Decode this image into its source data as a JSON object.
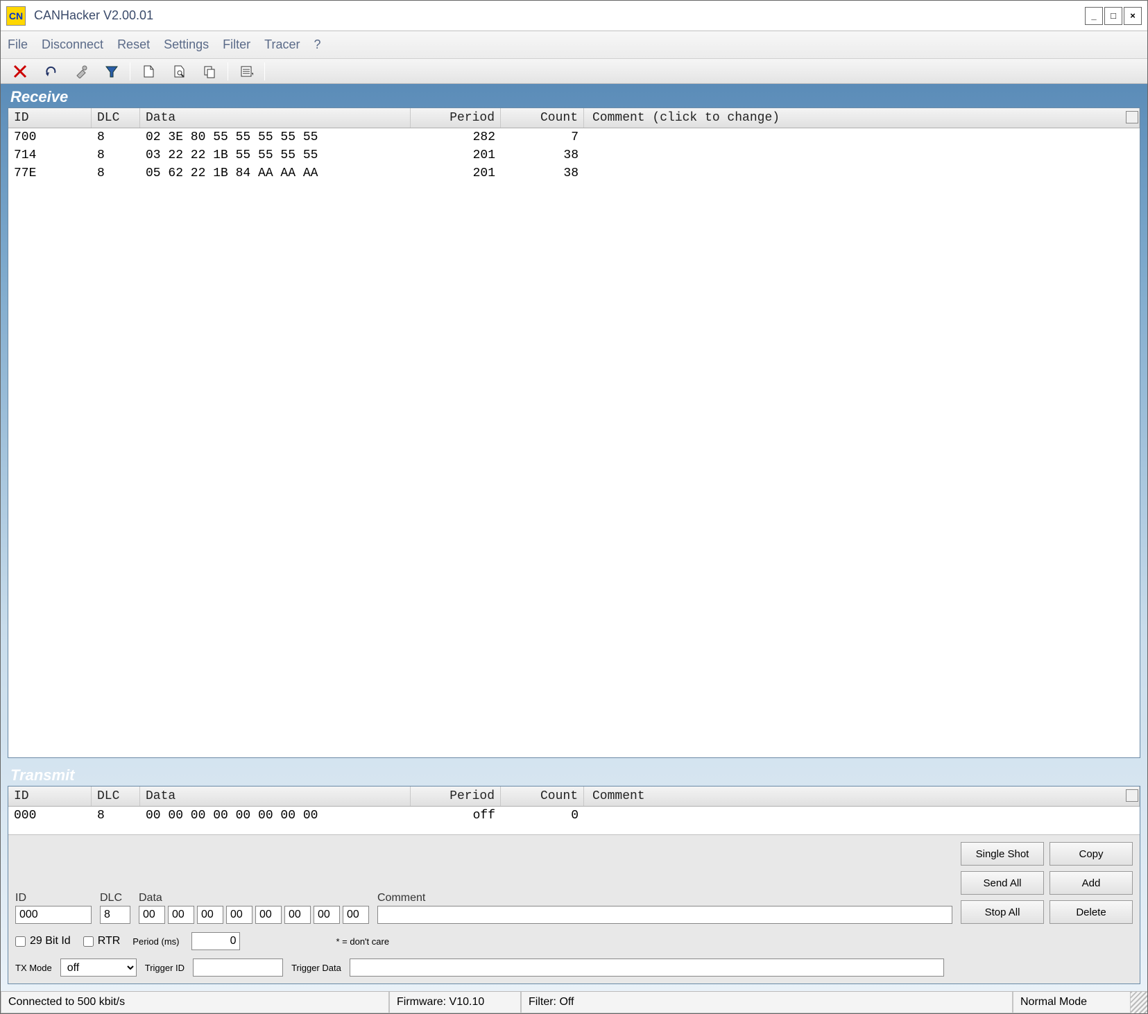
{
  "window": {
    "title": "CANHacker V2.00.01"
  },
  "menu": {
    "file": "File",
    "disconnect": "Disconnect",
    "reset": "Reset",
    "settings": "Settings",
    "filter": "Filter",
    "tracer": "Tracer",
    "help": "?"
  },
  "receive": {
    "title": "Receive",
    "headers": {
      "id": "ID",
      "dlc": "DLC",
      "data": "Data",
      "period": "Period",
      "count": "Count",
      "comment": "Comment (click to change)"
    },
    "rows": [
      {
        "id": "700",
        "dlc": "8",
        "data": "02 3E 80 55 55 55 55 55",
        "period": "282",
        "count": "7",
        "comment": ""
      },
      {
        "id": "714",
        "dlc": "8",
        "data": "03 22 22 1B 55 55 55 55",
        "period": "201",
        "count": "38",
        "comment": ""
      },
      {
        "id": "77E",
        "dlc": "8",
        "data": "05 62 22 1B 84 AA AA AA",
        "period": "201",
        "count": "38",
        "comment": ""
      }
    ]
  },
  "transmit": {
    "title": "Transmit",
    "headers": {
      "id": "ID",
      "dlc": "DLC",
      "data": "Data",
      "period": "Period",
      "count": "Count",
      "comment": "Comment"
    },
    "rows": [
      {
        "id": "000",
        "dlc": "8",
        "data": "00 00 00 00 00 00 00 00",
        "period": "off",
        "count": "0",
        "comment": ""
      }
    ],
    "form": {
      "id_label": "ID",
      "id": "000",
      "dlc_label": "DLC",
      "dlc": "8",
      "data_label": "Data",
      "bytes": [
        "00",
        "00",
        "00",
        "00",
        "00",
        "00",
        "00",
        "00"
      ],
      "comment_label": "Comment",
      "comment": "",
      "bit29_label": "29 Bit Id",
      "rtr_label": "RTR",
      "period_label": "Period (ms)",
      "period": "0",
      "dontcare": "* = don't care",
      "txmode_label": "TX Mode",
      "txmode": "off",
      "triggerid_label": "Trigger ID",
      "triggerid": "",
      "triggerdata_label": "Trigger Data",
      "triggerdata": ""
    },
    "buttons": {
      "single": "Single Shot",
      "copy": "Copy",
      "sendall": "Send All",
      "add": "Add",
      "stopall": "Stop All",
      "delete": "Delete"
    }
  },
  "status": {
    "conn": "Connected to 500 kbit/s",
    "fw": "Firmware: V10.10",
    "filter": "Filter: Off",
    "mode": "Normal Mode"
  }
}
